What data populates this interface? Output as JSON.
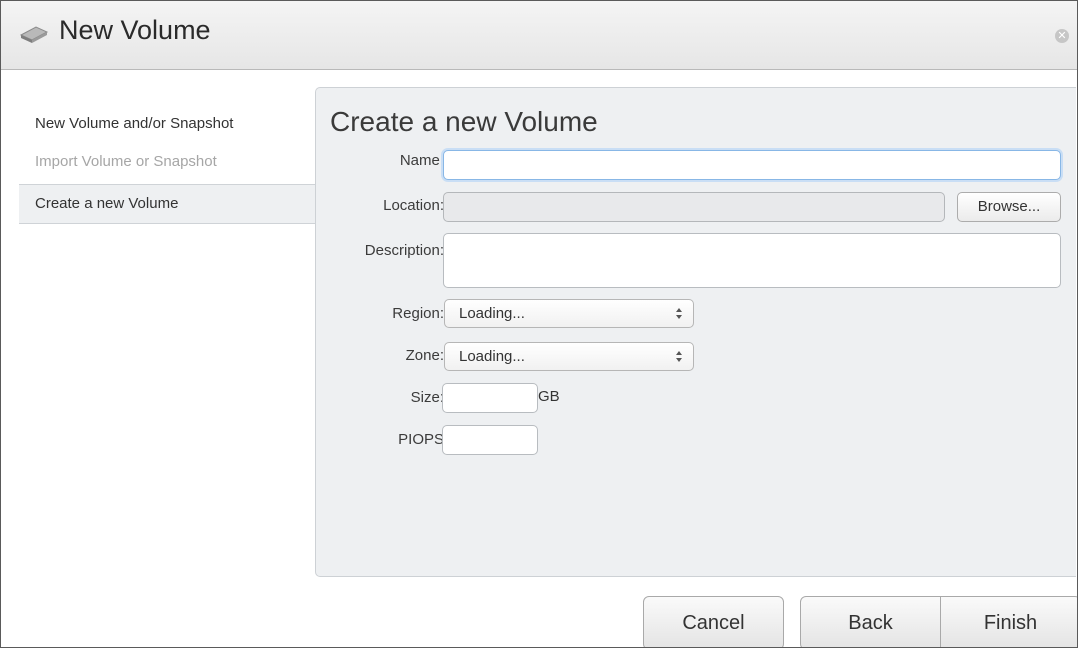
{
  "window": {
    "title": "New Volume",
    "icon": "drive-icon",
    "close_icon": "close-icon"
  },
  "sidebar": {
    "items": [
      {
        "label": "New Volume and/or Snapshot",
        "state": "normal"
      },
      {
        "label": "Import Volume or Snapshot",
        "state": "disabled"
      },
      {
        "label": "Create a new Volume",
        "state": "active"
      }
    ]
  },
  "form": {
    "heading": "Create a new Volume",
    "name": {
      "label": "Name:",
      "value": ""
    },
    "location": {
      "label": "Location:",
      "value": "",
      "browse_label": "Browse..."
    },
    "description": {
      "label": "Description:",
      "value": ""
    },
    "region": {
      "label": "Region:",
      "selected": "Loading..."
    },
    "zone": {
      "label": "Zone:",
      "selected": "Loading..."
    },
    "size": {
      "label": "Size:",
      "value": "",
      "unit": "GB"
    },
    "piops": {
      "label": "PIOPS",
      "value": ""
    }
  },
  "footer": {
    "cancel_label": "Cancel",
    "back_label": "Back",
    "finish_label": "Finish"
  },
  "colors": {
    "panel_bg": "#eef0f2",
    "focus_ring": "#88b7e6",
    "disabled_text": "#a6a6a6"
  }
}
